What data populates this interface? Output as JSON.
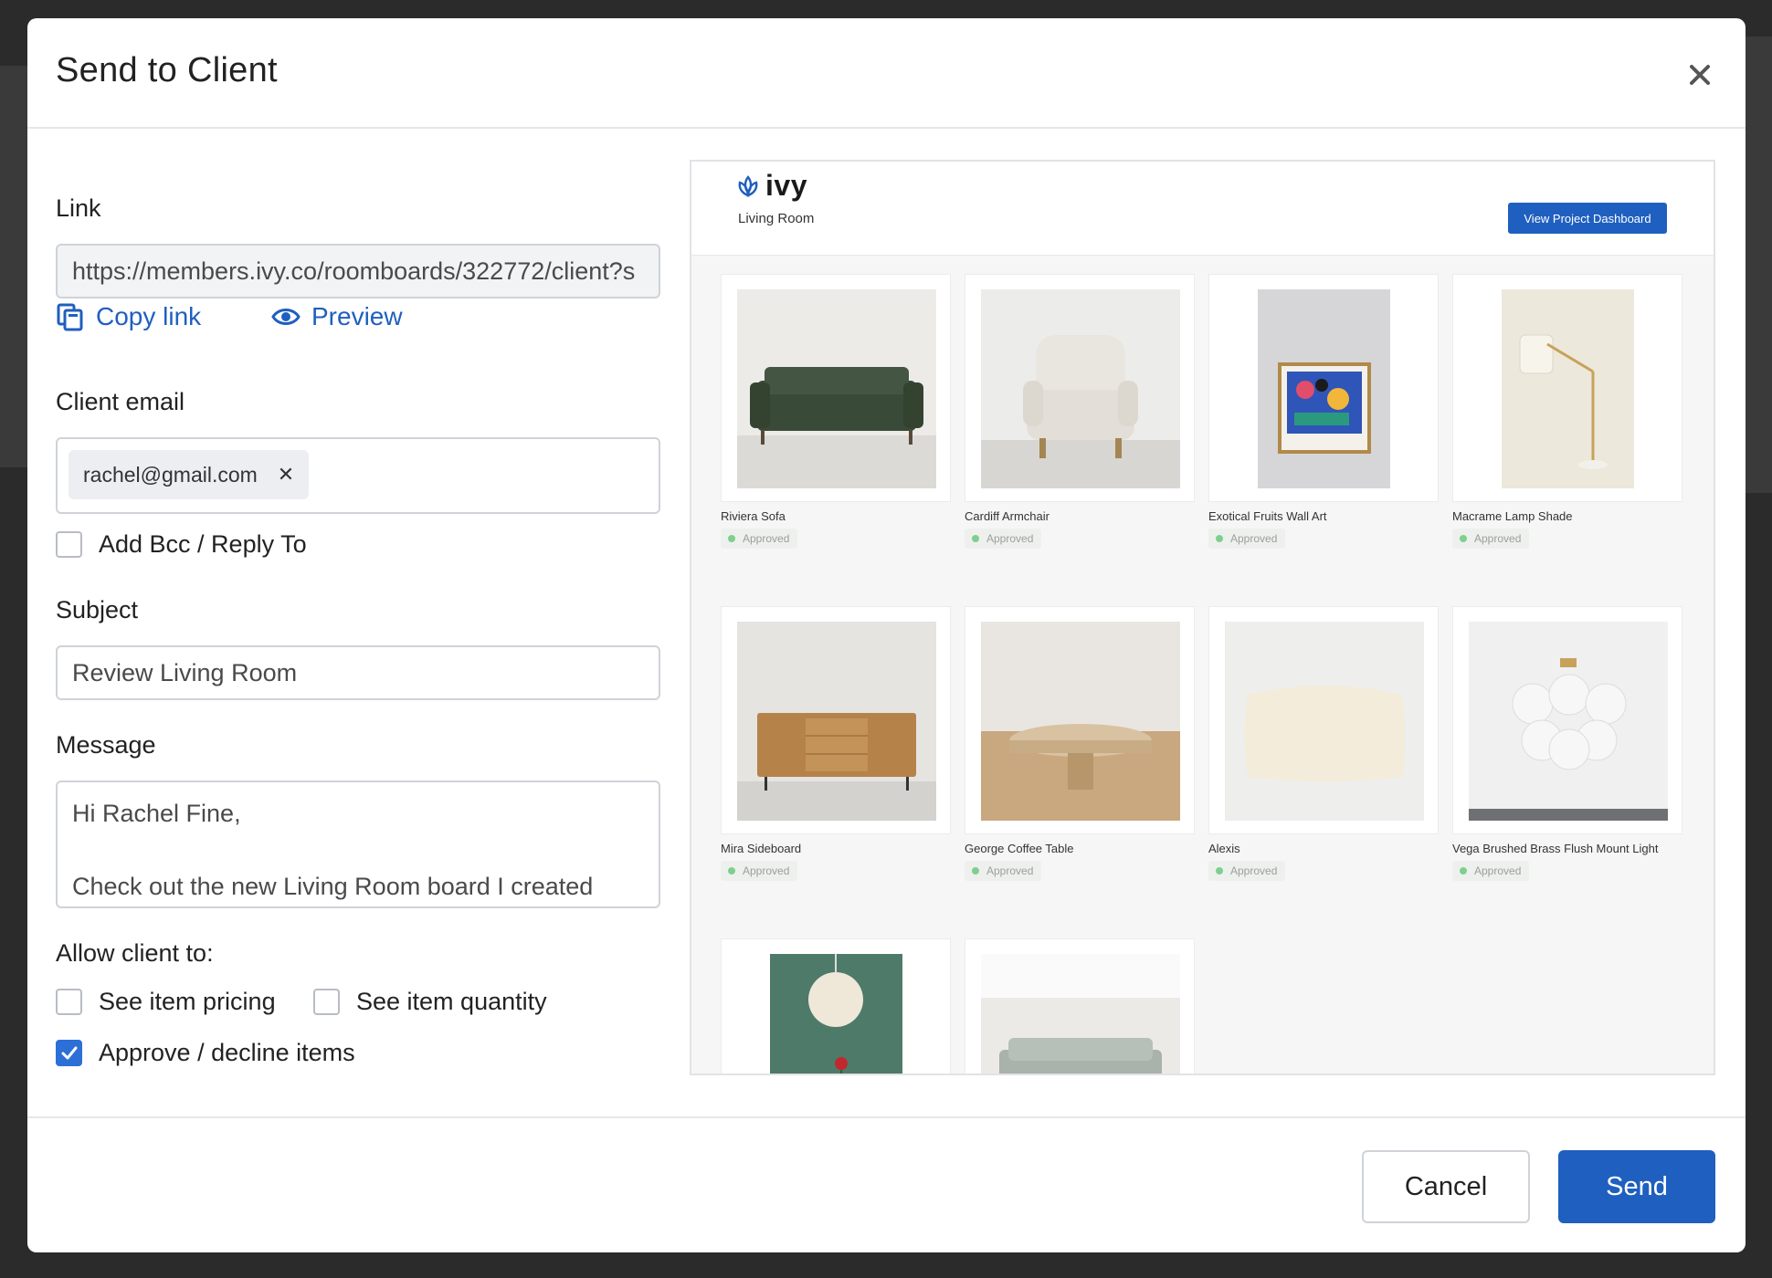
{
  "modal": {
    "title": "Send to Client"
  },
  "form": {
    "link_label": "Link",
    "link_value": "https://members.ivy.co/roomboards/322772/client?s",
    "copy_link_label": "Copy link",
    "preview_label": "Preview",
    "client_email_label": "Client email",
    "email_chip": "rachel@gmail.com",
    "bcc_label": "Add Bcc / Reply To",
    "bcc_checked": false,
    "subject_label": "Subject",
    "subject_value": "Review Living Room",
    "message_label": "Message",
    "message_line1": "Hi Rachel Fine,",
    "message_line2": "Check out the new Living Room board I created",
    "allow_label": "Allow client to:",
    "options": {
      "pricing": {
        "label": "See item pricing",
        "checked": false
      },
      "quantity": {
        "label": "See item quantity",
        "checked": false
      },
      "approve": {
        "label": "Approve / decline items",
        "checked": true
      }
    }
  },
  "preview": {
    "brand": "ivy",
    "room": "Living Room",
    "dashboard_button": "View Project Dashboard",
    "items": [
      {
        "name": "Riviera Sofa",
        "status": "Approved",
        "icon": "sofa-image"
      },
      {
        "name": "Cardiff Armchair",
        "status": "Approved",
        "icon": "armchair-image"
      },
      {
        "name": "Exotical Fruits Wall Art",
        "status": "Approved",
        "icon": "wall-art-image"
      },
      {
        "name": "Macrame Lamp Shade",
        "status": "Approved",
        "icon": "floor-lamp-image"
      },
      {
        "name": "Mira Sideboard",
        "status": "Approved",
        "icon": "sideboard-image"
      },
      {
        "name": "George Coffee Table",
        "status": "Approved",
        "icon": "coffee-table-image"
      },
      {
        "name": "Alexis",
        "status": "Approved",
        "icon": "pillow-image"
      },
      {
        "name": "Vega Brushed Brass Flush Mount Light",
        "status": "Approved",
        "icon": "ceiling-light-image"
      },
      {
        "name": "",
        "status": "",
        "icon": "pendant-light-image"
      },
      {
        "name": "",
        "status": "",
        "icon": "grey-sofa-image"
      }
    ]
  },
  "footer": {
    "cancel_label": "Cancel",
    "send_label": "Send"
  },
  "colors": {
    "accent": "#1f5fbf",
    "checkbox_checked": "#2c6fd6",
    "approved_dot": "#7fcf8f"
  }
}
